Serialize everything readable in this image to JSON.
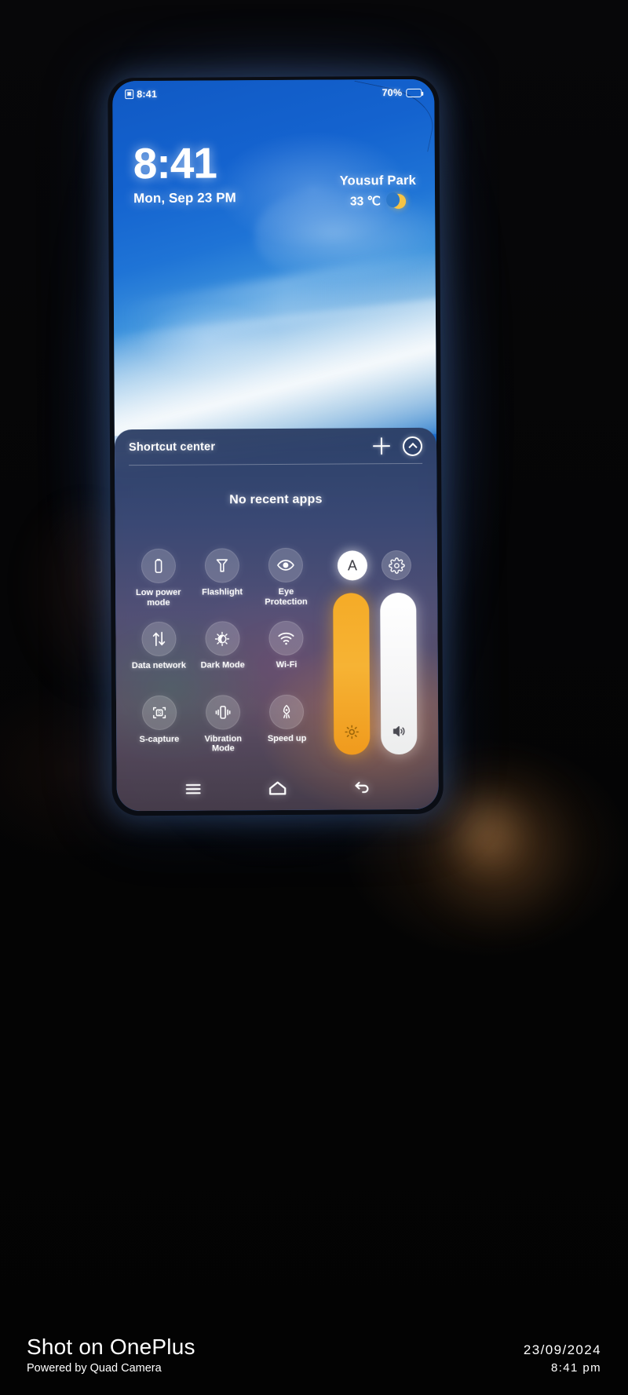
{
  "statusbar": {
    "time": "8:41",
    "sim_icon": "sim-card-icon",
    "battery_percent": "70%",
    "battery_icon": "battery-icon"
  },
  "lockscreen": {
    "time": "8:41",
    "date": "Mon, Sep 23 PM",
    "weather": {
      "location": "Yousuf Park",
      "temperature": "33 ℃",
      "condition_icon": "crescent-moon-icon"
    }
  },
  "shortcut_center": {
    "title": "Shortcut center",
    "add_icon": "plus-icon",
    "collapse_icon": "chevron-up-circle-icon",
    "empty_state": "No recent apps",
    "tiles": [
      {
        "label": "Low power mode",
        "icon": "battery-saver-icon"
      },
      {
        "label": "Flashlight",
        "icon": "flashlight-icon"
      },
      {
        "label": "Eye Protection",
        "icon": "eye-icon"
      },
      {
        "label": "Data network",
        "icon": "data-transfer-icon"
      },
      {
        "label": "Dark Mode",
        "icon": "dark-mode-icon"
      },
      {
        "label": "Wi-Fi",
        "icon": "wifi-icon"
      },
      {
        "label": "S-capture",
        "icon": "screenshot-icon"
      },
      {
        "label": "Vibration Mode",
        "icon": "vibration-icon"
      },
      {
        "label": "Speed up",
        "icon": "rocket-icon"
      }
    ],
    "auto_brightness": {
      "label": "A",
      "icon": "auto-brightness-icon"
    },
    "settings": {
      "icon": "gear-icon"
    },
    "brightness_slider": {
      "icon": "brightness-sun-icon",
      "color": "#f5ab27",
      "level": 100
    },
    "volume_slider": {
      "icon": "speaker-volume-icon",
      "color": "#ffffff",
      "level": 100
    }
  },
  "navbar": {
    "recents_icon": "menu-recents-icon",
    "home_icon": "home-icon",
    "back_icon": "back-icon"
  },
  "watermark": {
    "title": "Shot on OnePlus",
    "subtitle": "Powered by Quad Camera",
    "date": "23/09/2024",
    "time": "8:41 pm"
  }
}
